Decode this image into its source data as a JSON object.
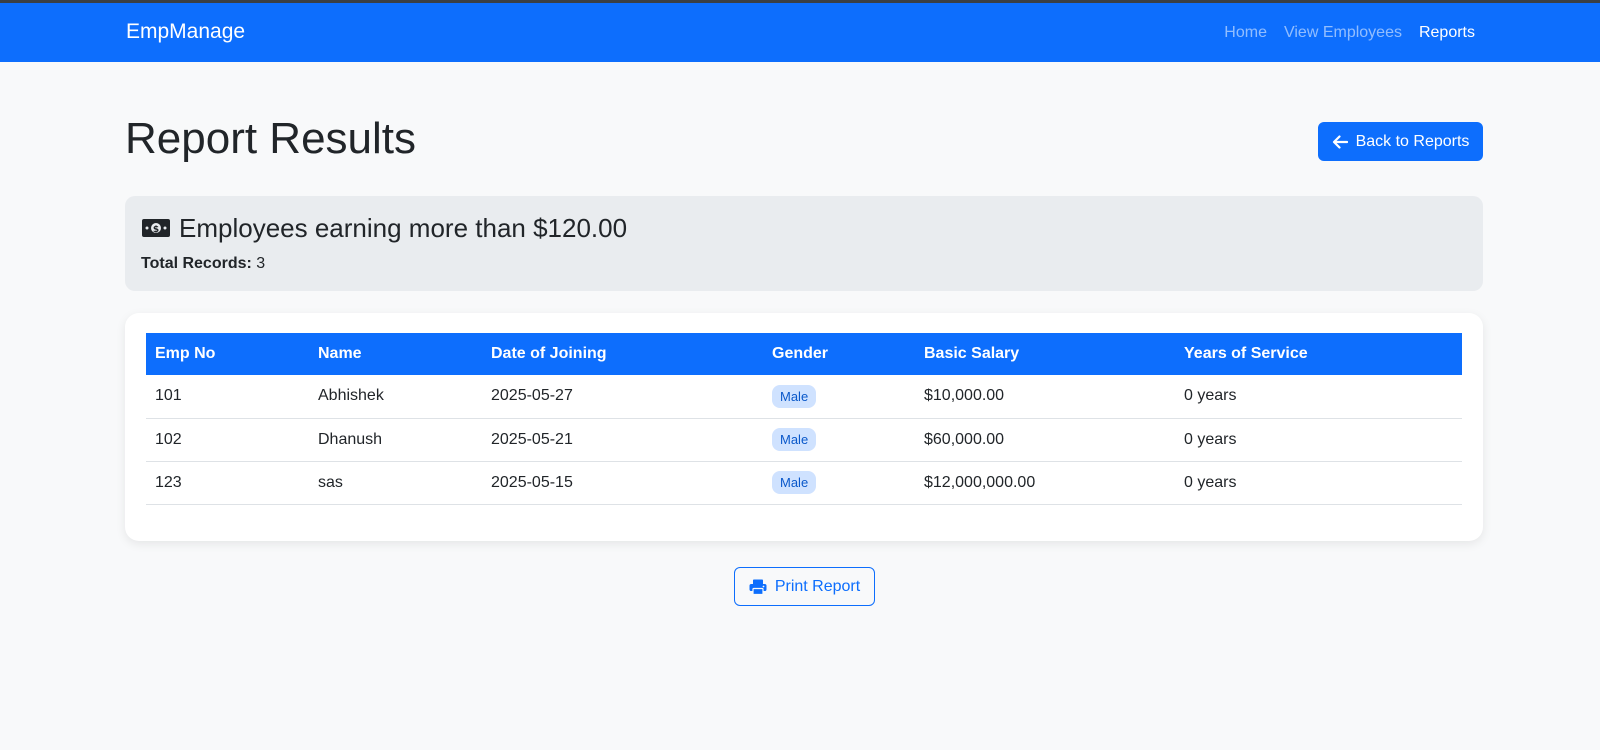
{
  "navbar": {
    "brand": "EmpManage",
    "links": [
      {
        "label": "Home",
        "active": false
      },
      {
        "label": "View Employees",
        "active": false
      },
      {
        "label": "Reports",
        "active": true
      }
    ]
  },
  "page": {
    "title": "Report Results",
    "back_button_label": "Back to Reports",
    "back_button_icon": "arrow-left-icon"
  },
  "summary": {
    "icon": "money-bill-icon",
    "heading": "Employees earning more than $120.00",
    "total_label": "Total Records:",
    "total_value": "3"
  },
  "table": {
    "headers": [
      "Emp No",
      "Name",
      "Date of Joining",
      "Gender",
      "Basic Salary",
      "Years of Service"
    ],
    "rows": [
      {
        "emp_no": "101",
        "name": "Abhishek",
        "doj": "2025-05-27",
        "gender": "Male",
        "salary": "$10,000.00",
        "service": "0 years"
      },
      {
        "emp_no": "102",
        "name": "Dhanush",
        "doj": "2025-05-21",
        "gender": "Male",
        "salary": "$60,000.00",
        "service": "0 years"
      },
      {
        "emp_no": "123",
        "name": "sas",
        "doj": "2025-05-15",
        "gender": "Male",
        "salary": "$12,000,000.00",
        "service": "0 years"
      }
    ]
  },
  "print_button": {
    "label": "Print Report",
    "icon": "printer-icon"
  },
  "colors": {
    "primary": "#0d6efd",
    "page_background": "#f8f9fa",
    "summary_background": "#e9ecef",
    "badge_background": "#cfe2ff"
  }
}
